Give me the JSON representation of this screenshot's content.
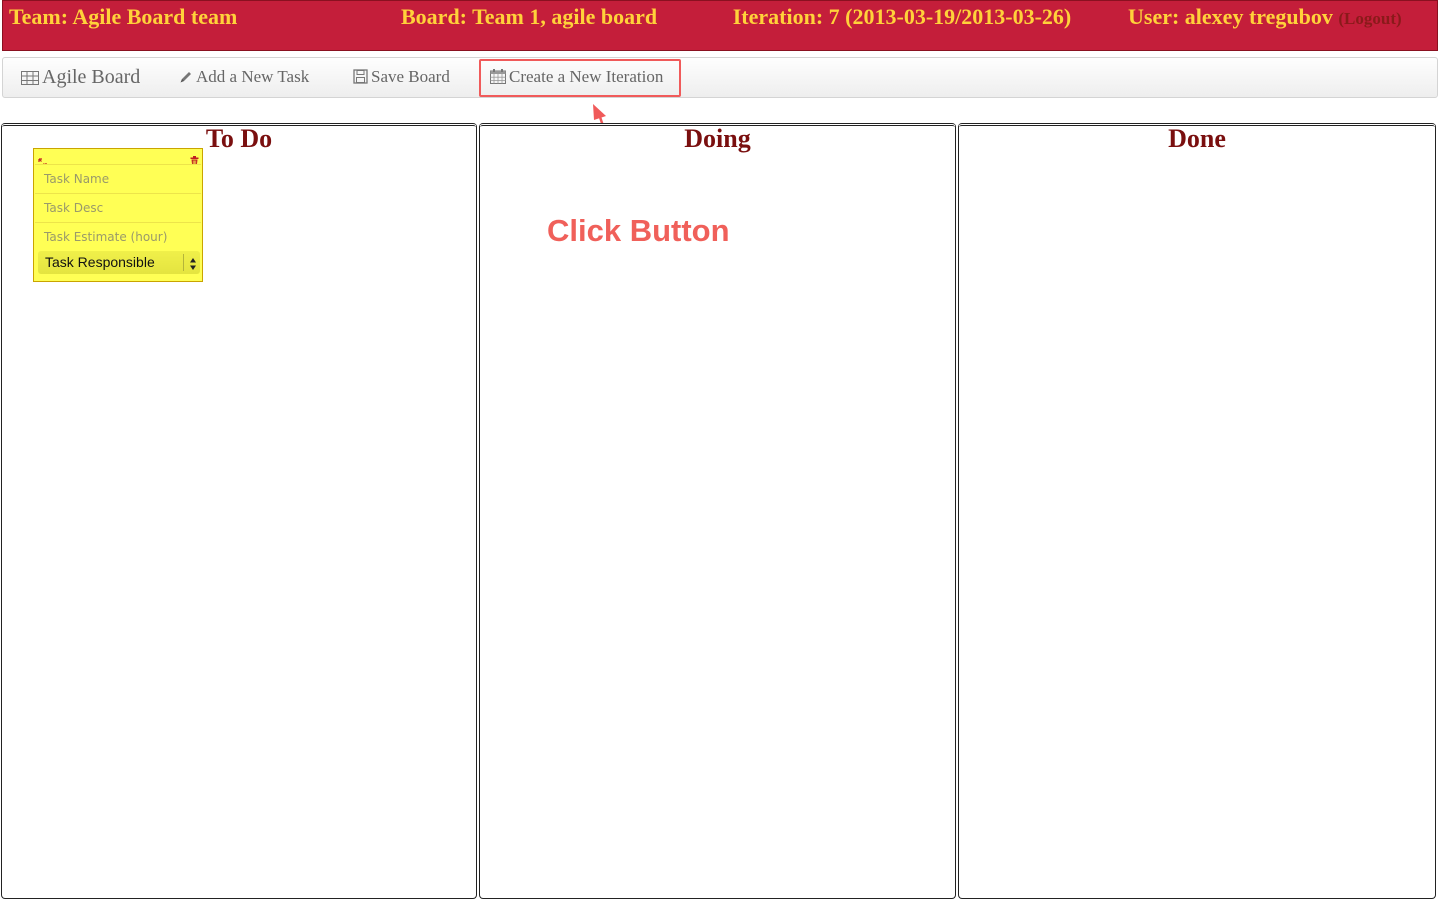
{
  "header": {
    "team": "Team: Agile Board team",
    "board": "Board: Team 1, agile board",
    "iteration": "Iteration: 7 (2013-03-19/2013-03-26)",
    "user": "User: alexey tregubov",
    "logout": "(Logout)"
  },
  "nav": {
    "brand": "Agile Board",
    "add_task": "Add a New Task",
    "save_board": "Save Board",
    "new_iteration": "Create a New Iteration"
  },
  "columns": {
    "todo": "To Do",
    "doing": "Doing",
    "done": "Done"
  },
  "task_card": {
    "name_placeholder": "Task Name",
    "desc_placeholder": "Task Desc",
    "estimate_placeholder": "Task Estimate (hour)",
    "responsible_selected": "Task Responsible"
  },
  "annotation": {
    "text": "Click Button"
  },
  "colors": {
    "header_bg": "#c41e3a",
    "header_text": "#ffd23a",
    "column_title": "#7a0f0f",
    "card_bg": "#ffff55",
    "annotation": "#f0605a"
  }
}
